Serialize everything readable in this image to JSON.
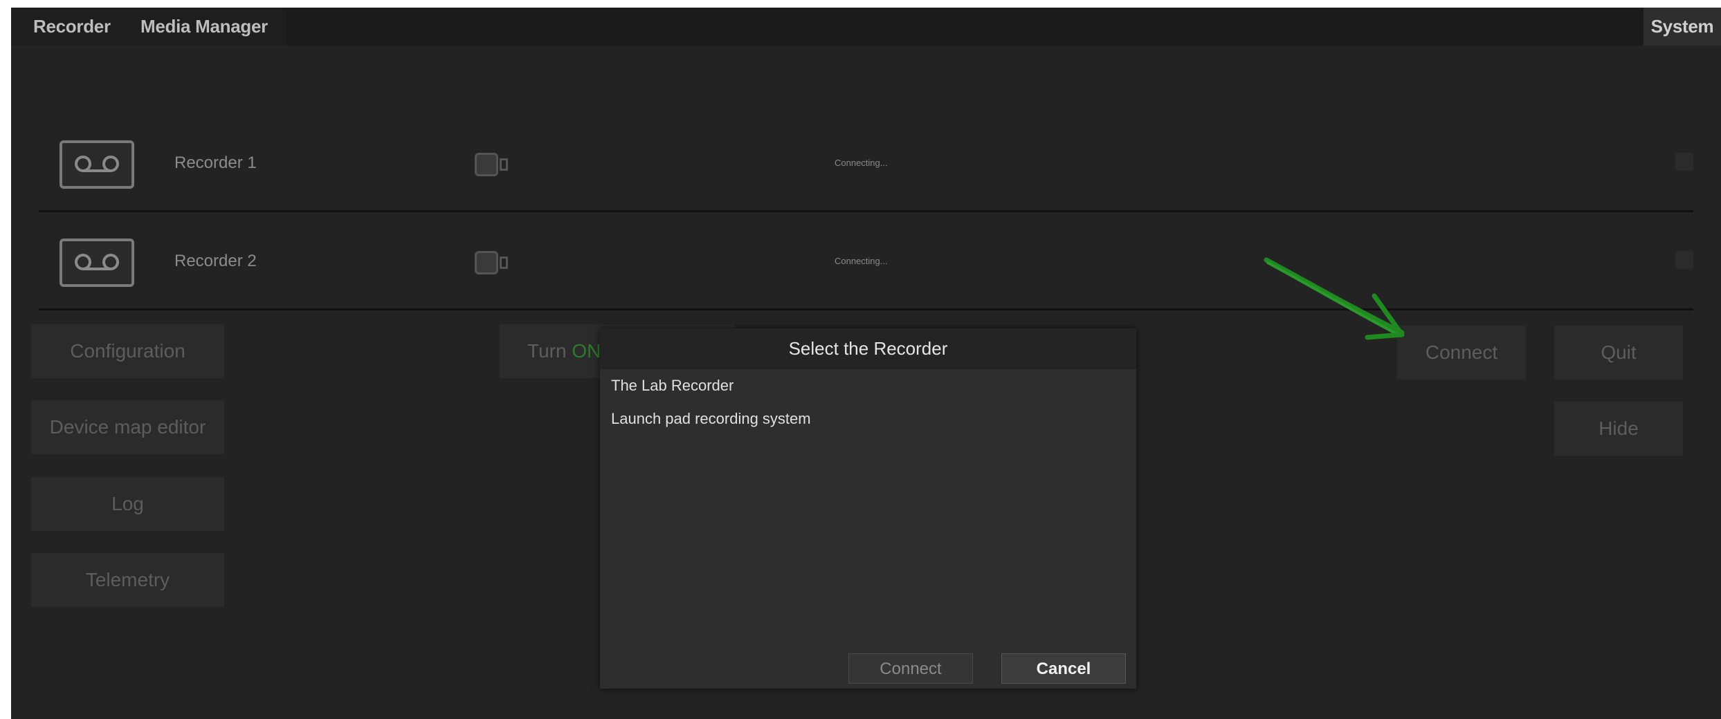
{
  "menubar": {
    "recorder": "Recorder",
    "media_manager": "Media Manager",
    "system": "System"
  },
  "recorders": [
    {
      "name": "Recorder 1",
      "status": "Connecting..."
    },
    {
      "name": "Recorder 2",
      "status": "Connecting..."
    }
  ],
  "left_buttons": {
    "configuration": "Configuration",
    "device_map_editor": "Device map editor",
    "log": "Log",
    "telemetry": "Telemetry"
  },
  "turn_button": {
    "prefix": "Turn",
    "state": "ON"
  },
  "right_buttons": {
    "connect": "Connect",
    "quit": "Quit",
    "hide": "Hide"
  },
  "dialog": {
    "title": "Select the Recorder",
    "items": [
      "The Lab Recorder",
      "Launch pad recording system"
    ],
    "connect": "Connect",
    "cancel": "Cancel"
  },
  "colors": {
    "background": "#232323",
    "menubar": "#1b1b1b",
    "button": "#2b2b2b",
    "annotation_arrow": "#1f8a1f"
  }
}
